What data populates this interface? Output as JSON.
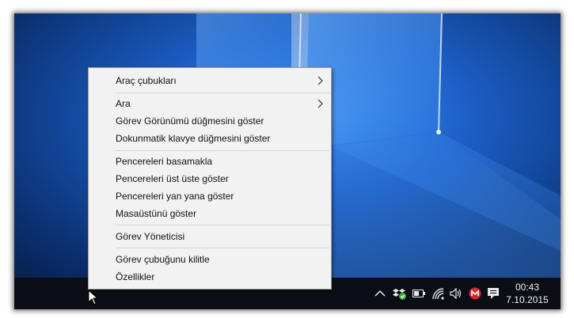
{
  "menu": {
    "items": [
      {
        "label": "Araç çubukları",
        "submenu": true
      },
      {
        "label": "Ara",
        "submenu": true
      },
      {
        "label": "Görev Görünümü düğmesini göster"
      },
      {
        "label": "Dokunmatik klavye düğmesini göster"
      },
      {
        "label": "Pencereleri basamakla"
      },
      {
        "label": "Pencereleri üst üste göster"
      },
      {
        "label": "Pencereleri yan yana göster"
      },
      {
        "label": "Masaüstünü göster"
      },
      {
        "label": "Görev Yöneticisi"
      },
      {
        "label": "Görev çubuğunu kilitle"
      },
      {
        "label": "Özellikler"
      }
    ]
  },
  "taskbar": {
    "time": "00:43",
    "date": "7.10.2015",
    "tray_icons": [
      "chevron-up-icon",
      "dropbox-icon",
      "battery-icon",
      "wifi-icon",
      "volume-icon",
      "mega-icon"
    ],
    "mega_color": "#d9272e",
    "dropbox_check_color": "#3cb043"
  },
  "colors": {
    "desktop_blue": "#1a5fc4",
    "taskbar": "#0b0e14",
    "menu_bg": "#f2f2f2"
  }
}
